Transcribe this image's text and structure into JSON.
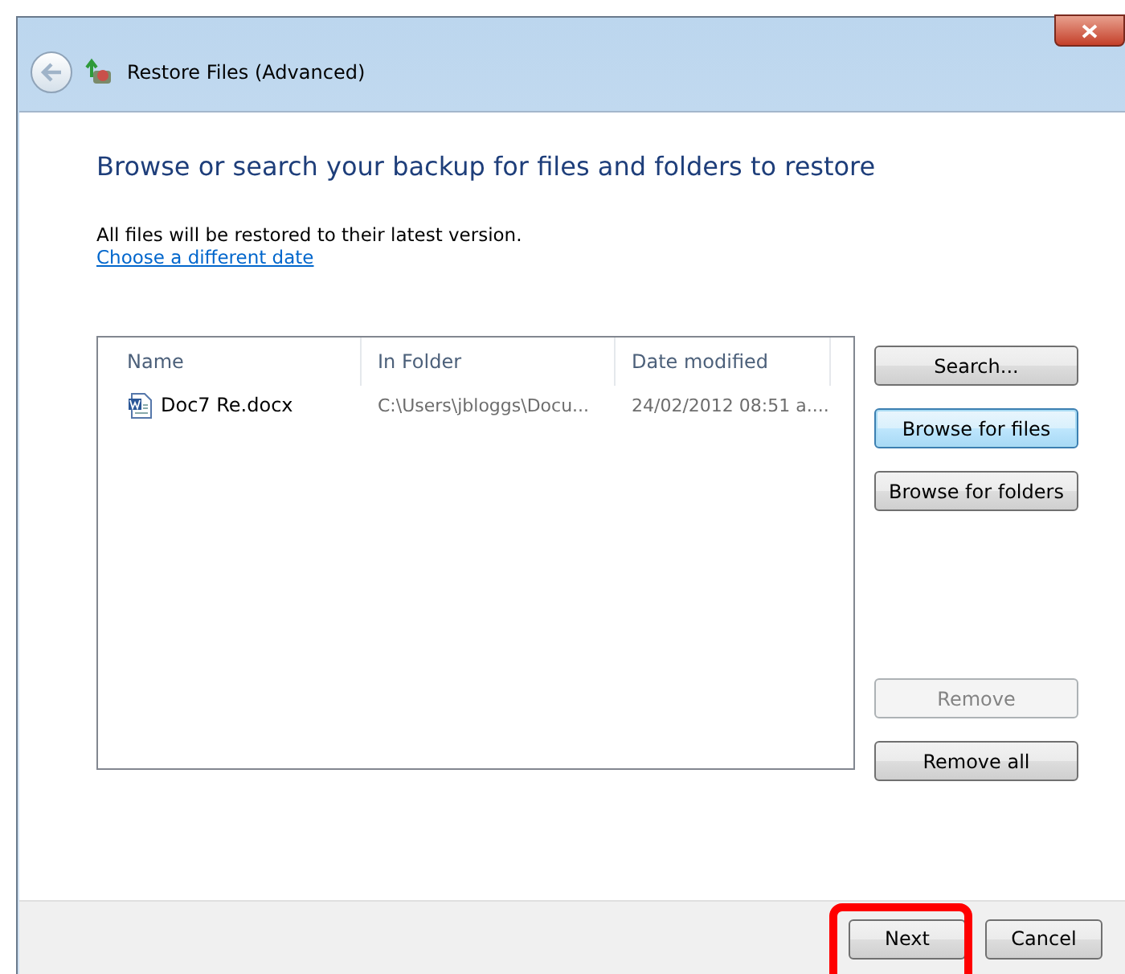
{
  "window": {
    "title": "Restore Files (Advanced)"
  },
  "heading": "Browse or search your backup for files and folders to restore",
  "info": "All files will be restored to their latest version.",
  "link": "Choose a different date",
  "list": {
    "columns": [
      "Name",
      "In Folder",
      "Date modified"
    ],
    "rows": [
      {
        "name": "Doc7 Re.docx",
        "folder": "C:\\Users\\jbloggs\\Docu...",
        "date": "24/02/2012 08:51 a...."
      }
    ]
  },
  "side_buttons": [
    {
      "label": "Search...",
      "disabled": false,
      "focused": false
    },
    {
      "label": "Browse for files",
      "disabled": false,
      "focused": true
    },
    {
      "label": "Browse for folders",
      "disabled": false,
      "focused": false
    },
    {
      "label": "Remove",
      "disabled": true,
      "focused": false
    },
    {
      "label": "Remove all",
      "disabled": false,
      "focused": false
    }
  ],
  "footer_buttons": [
    {
      "label": "Next",
      "highlighted": true
    },
    {
      "label": "Cancel",
      "highlighted": false
    }
  ]
}
